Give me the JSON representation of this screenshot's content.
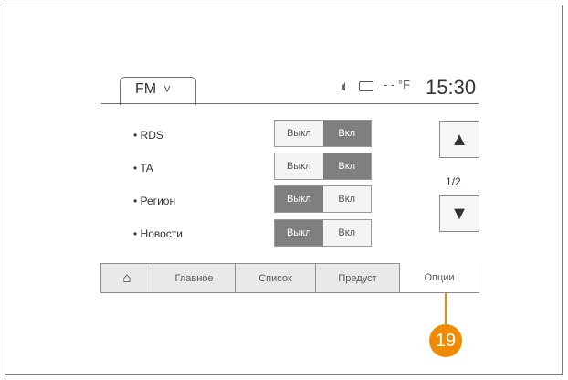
{
  "header": {
    "source_label": "FM",
    "source_chevron": "˅",
    "status_signal": ".ııl",
    "status_temp": "- - °F",
    "time": "15:30"
  },
  "settings": [
    {
      "label": "• RDS",
      "off": "Выкл",
      "on": "Вкл",
      "selected": "on"
    },
    {
      "label": "• TA",
      "off": "Выкл",
      "on": "Вкл",
      "selected": "on"
    },
    {
      "label": "• Регион",
      "off": "Выкл",
      "on": "Вкл",
      "selected": "off"
    },
    {
      "label": "• Новости",
      "off": "Выкл",
      "on": "Вкл",
      "selected": "off"
    }
  ],
  "scroll": {
    "up_icon": "▲",
    "down_icon": "▼",
    "page_indicator": "1/2"
  },
  "bottom_tabs": {
    "home_icon": "⌂",
    "main": "Главное",
    "list": "Список",
    "preset": "Предуст",
    "options": "Опции"
  },
  "callout": {
    "number": "19",
    "color": "#f08a00"
  }
}
